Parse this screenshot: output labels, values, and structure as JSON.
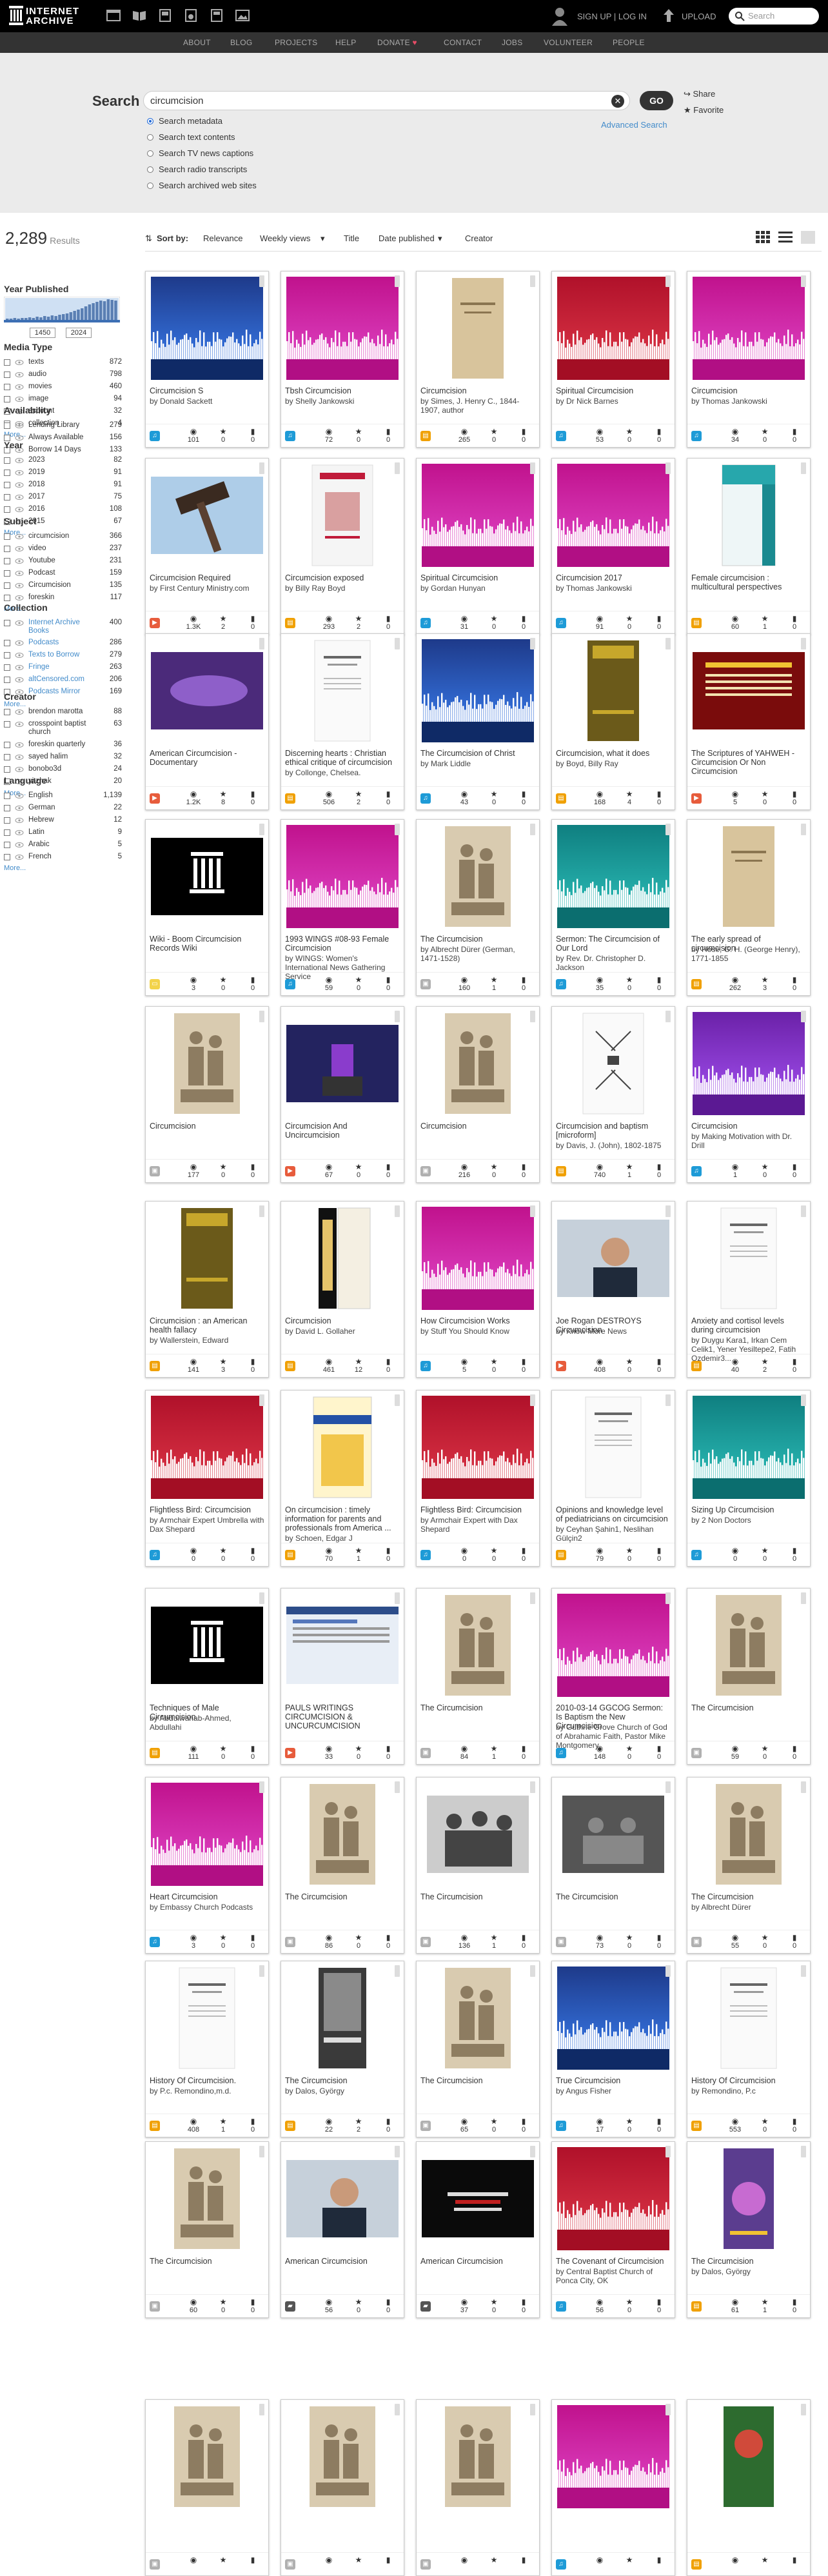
{
  "header": {
    "logo_line1": "INTERNET",
    "logo_line2": "ARCHIVE",
    "signup": "SIGN UP | LOG IN",
    "upload": "UPLOAD",
    "search_placeholder": "Search"
  },
  "nav": [
    "ABOUT",
    "BLOG",
    "PROJECTS",
    "HELP",
    "DONATE",
    "CONTACT",
    "JOBS",
    "VOLUNTEER",
    "PEOPLE"
  ],
  "search": {
    "label": "Search",
    "query": "circumcision",
    "go": "GO",
    "share": "Share",
    "favorite": "Favorite",
    "advanced": "Advanced Search",
    "options": [
      "Search metadata",
      "Search text contents",
      "Search TV news captions",
      "Search radio transcripts",
      "Search archived web sites"
    ]
  },
  "results": {
    "count": "2,289",
    "label": "Results"
  },
  "facets": {
    "year_published": {
      "title": "Year Published",
      "from": "1450",
      "to": "2024"
    },
    "media_type": {
      "title": "Media Type",
      "rows": [
        [
          "texts",
          "872"
        ],
        [
          "audio",
          "798"
        ],
        [
          "movies",
          "460"
        ],
        [
          "image",
          "94"
        ],
        [
          "account",
          "32"
        ],
        [
          "collection",
          "4"
        ]
      ],
      "more": "More..."
    },
    "availability": {
      "title": "Availability",
      "rows": [
        [
          "Lending Library",
          "279"
        ],
        [
          "Always Available",
          "156"
        ],
        [
          "Borrow 14 Days",
          "133"
        ]
      ]
    },
    "year": {
      "title": "Year",
      "rows": [
        [
          "2023",
          "82"
        ],
        [
          "2019",
          "91"
        ],
        [
          "2018",
          "91"
        ],
        [
          "2017",
          "75"
        ],
        [
          "2016",
          "108"
        ],
        [
          "2015",
          "67"
        ]
      ],
      "more": "More..."
    },
    "subject": {
      "title": "Subject",
      "rows": [
        [
          "circumcision",
          "366"
        ],
        [
          "video",
          "237"
        ],
        [
          "Youtube",
          "231"
        ],
        [
          "Podcast",
          "159"
        ],
        [
          "Circumcision",
          "135"
        ],
        [
          "foreskin",
          "117"
        ]
      ],
      "more": "More..."
    },
    "collection": {
      "title": "Collection",
      "rows": [
        [
          "Internet Archive Books",
          "400"
        ],
        [
          "Podcasts",
          "286"
        ],
        [
          "Texts to Borrow",
          "279"
        ],
        [
          "Fringe",
          "263"
        ],
        [
          "altCensored.com",
          "206"
        ],
        [
          "Podcasts Mirror",
          "169"
        ]
      ],
      "more": "More..."
    },
    "creator": {
      "title": "Creator",
      "rows": [
        [
          "brendon marotta",
          "88"
        ],
        [
          "crosspoint baptist church",
          "63"
        ],
        [
          "foreskin quarterly",
          "36"
        ],
        [
          "sayed halim",
          "32"
        ],
        [
          "bonobo3d",
          "24"
        ],
        [
          "yitzhak",
          "20"
        ]
      ],
      "more": "More..."
    },
    "language": {
      "title": "Language",
      "rows": [
        [
          "English",
          "1,139"
        ],
        [
          "German",
          "22"
        ],
        [
          "Hebrew",
          "12"
        ],
        [
          "Latin",
          "9"
        ],
        [
          "Arabic",
          "5"
        ],
        [
          "French",
          "5"
        ]
      ],
      "more": "More..."
    }
  },
  "sort": {
    "label": "Sort by:",
    "options": [
      "Relevance",
      "Weekly views",
      "Title",
      "Date published",
      "Creator"
    ]
  },
  "colors": {
    "topbar": "#000000",
    "navbar": "#333333",
    "search_bg": "#ebebeb",
    "link": "#428bca",
    "audio_badge": "#1e9bd7",
    "texts_badge": "#f0a000",
    "movies_badge": "#e75c3c",
    "image_badge": "#b0b0b0"
  },
  "cards": [
    {
      "title": "Circumcision S",
      "creator": "by Donald Sackett",
      "type": "audio",
      "views": "101",
      "favs": "0",
      "reviews": "0",
      "thumb": "wave-blue"
    },
    {
      "title": "Tbsh Circumcision",
      "creator": "by Shelly Jankowski",
      "type": "audio",
      "views": "72",
      "favs": "0",
      "reviews": "0",
      "thumb": "wave-magenta"
    },
    {
      "title": "Circumcision",
      "creator": "by Simes, J. Henry C., 1844-1907, author",
      "type": "texts",
      "views": "265",
      "favs": "0",
      "reviews": "0",
      "thumb": "book-tan"
    },
    {
      "title": "Spiritual Circumcision",
      "creator": "by Dr Nick Barnes",
      "type": "audio",
      "views": "53",
      "favs": "0",
      "reviews": "0",
      "thumb": "wave-red"
    },
    {
      "title": "Circumcision",
      "creator": "by Thomas Jankowski",
      "type": "audio",
      "views": "34",
      "favs": "0",
      "reviews": "0",
      "thumb": "wave-magenta"
    },
    {
      "title": "Circumcision Required",
      "creator": "by First Century Ministry.com",
      "type": "movies",
      "views": "1.3K",
      "favs": "2",
      "reviews": "0",
      "thumb": "video-hammer"
    },
    {
      "title": "Circumcision exposed",
      "creator": "by Billy Ray Boyd",
      "type": "texts",
      "views": "293",
      "favs": "2",
      "reviews": "0",
      "thumb": "book-cover"
    },
    {
      "title": "Spiritual Circumcision",
      "creator": "by Gordan Hunyan",
      "type": "audio",
      "views": "31",
      "favs": "0",
      "reviews": "0",
      "thumb": "wave-magenta"
    },
    {
      "title": "Circumcision 2017",
      "creator": "by Thomas Jankowski",
      "type": "audio",
      "views": "91",
      "favs": "0",
      "reviews": "0",
      "thumb": "wave-magenta"
    },
    {
      "title": "Female circumcision : multicultural perspectives",
      "creator": "",
      "type": "texts",
      "views": "60",
      "favs": "1",
      "reviews": "0",
      "thumb": "book-teal"
    },
    {
      "title": "American Circumcision - Documentary",
      "creator": "",
      "type": "movies",
      "views": "1.2K",
      "favs": "8",
      "reviews": "0",
      "thumb": "video-purple"
    },
    {
      "title": "Discerning hearts : Christian ethical critique of circumcision",
      "creator": "by Collonge, Chelsea.",
      "type": "texts",
      "views": "506",
      "favs": "2",
      "reviews": "0",
      "thumb": "book-white"
    },
    {
      "title": "The Circumcision of Christ",
      "creator": "by Mark Liddle",
      "type": "audio",
      "views": "43",
      "favs": "0",
      "reviews": "0",
      "thumb": "wave-blue"
    },
    {
      "title": "Circumcision, what it does",
      "creator": "by Boyd, Billy Ray",
      "type": "texts",
      "views": "168",
      "favs": "4",
      "reviews": "0",
      "thumb": "book-olive"
    },
    {
      "title": "The Scriptures of YAHWEH - Circumcision Or Non Circumcision",
      "creator": "",
      "type": "movies",
      "views": "5",
      "favs": "0",
      "reviews": "0",
      "thumb": "video-red"
    },
    {
      "title": "Wiki - Boom Circumcision Records Wiki",
      "creator": "",
      "type": "web",
      "views": "3",
      "favs": "0",
      "reviews": "0",
      "thumb": "temple"
    },
    {
      "title": "1993 WINGS #08-93 Female Circumcision",
      "creator": "by WINGS: Women's International News Gathering Service",
      "type": "audio",
      "views": "59",
      "favs": "0",
      "reviews": "0",
      "thumb": "wave-magenta"
    },
    {
      "title": "The Circumcision",
      "creator": "by Albrecht Dürer (German, 1471-1528)",
      "type": "image",
      "views": "160",
      "favs": "1",
      "reviews": "0",
      "thumb": "engraving"
    },
    {
      "title": "Sermon: The Circumcision of Our Lord",
      "creator": "by Rev. Dr. Christopher D. Jackson",
      "type": "audio",
      "views": "35",
      "favs": "0",
      "reviews": "0",
      "thumb": "wave-teal"
    },
    {
      "title": "The early spread of circumcision",
      "creator": "by Hose, G. H. (George Henry), 1771-1855",
      "type": "texts",
      "views": "262",
      "favs": "3",
      "reviews": "0",
      "thumb": "book-tan"
    },
    {
      "title": "Circumcision",
      "creator": "",
      "type": "image",
      "views": "177",
      "favs": "0",
      "reviews": "0",
      "thumb": "engraving"
    },
    {
      "title": "Circumcision And Uncircumcision",
      "creator": "",
      "type": "movies",
      "views": "67",
      "favs": "0",
      "reviews": "0",
      "thumb": "video-stage"
    },
    {
      "title": "Circumcision",
      "creator": "",
      "type": "image",
      "views": "216",
      "favs": "0",
      "reviews": "0",
      "thumb": "engraving"
    },
    {
      "title": "Circumcision and baptism [microform]",
      "creator": "by Davis, J. (John), 1802-1875",
      "type": "texts",
      "views": "740",
      "favs": "1",
      "reviews": "0",
      "thumb": "book-diagram"
    },
    {
      "title": "Circumcision",
      "creator": "by Making Motivation with Dr. Drill",
      "type": "audio",
      "views": "1",
      "favs": "0",
      "reviews": "0",
      "thumb": "wave-purple"
    },
    {
      "title": "Circumcision : an American health fallacy",
      "creator": "by Wallerstein, Edward",
      "type": "texts",
      "views": "141",
      "favs": "3",
      "reviews": "0",
      "thumb": "book-olive"
    },
    {
      "title": "Circumcision",
      "creator": "by David L. Gollaher",
      "type": "texts",
      "views": "461",
      "favs": "12",
      "reviews": "0",
      "thumb": "book-black"
    },
    {
      "title": "How Circumcision Works",
      "creator": "by Stuff You Should Know",
      "type": "audio",
      "views": "5",
      "favs": "0",
      "reviews": "0",
      "thumb": "wave-magenta"
    },
    {
      "title": "Joe Rogan DESTROYS Circumcision",
      "creator": "by Know More News",
      "type": "movies",
      "views": "408",
      "favs": "0",
      "reviews": "0",
      "thumb": "video-man"
    },
    {
      "title": "Anxiety and cortisol levels during circumcision",
      "creator": "by Duygu Kara1, Irkan Cem Celik1, Yener Yesiltepe2, Fatih Ozdemir3...",
      "type": "texts",
      "views": "40",
      "favs": "2",
      "reviews": "0",
      "thumb": "book-white"
    },
    {
      "title": "Flightless Bird: Circumcision",
      "creator": "by Armchair Expert Umbrella with Dax Shepard",
      "type": "audio",
      "views": "0",
      "favs": "0",
      "reviews": "0",
      "thumb": "wave-red"
    },
    {
      "title": "On circumcision : timely information for parents and professionals from America ...",
      "creator": "by Schoen, Edgar J",
      "type": "texts",
      "views": "70",
      "favs": "1",
      "reviews": "0",
      "thumb": "book-yellow"
    },
    {
      "title": "Flightless Bird: Circumcision",
      "creator": "by Armchair Expert with Dax Shepard",
      "type": "audio",
      "views": "0",
      "favs": "0",
      "reviews": "0",
      "thumb": "wave-red"
    },
    {
      "title": "Opinions and knowledge level of pediatricians on circumcision",
      "creator": "by Ceyhan Şahin1, Neslihan Gülçin2",
      "type": "texts",
      "views": "79",
      "favs": "0",
      "reviews": "0",
      "thumb": "book-white"
    },
    {
      "title": "Sizing Up Circumcision",
      "creator": "by 2 Non Doctors",
      "type": "audio",
      "views": "0",
      "favs": "0",
      "reviews": "0",
      "thumb": "wave-teal"
    },
    {
      "title": "Techniques of Male Circumcision.",
      "creator": "by Abdulwahab-Ahmed, Abdullahi",
      "type": "texts",
      "views": "111",
      "favs": "0",
      "reviews": "0",
      "thumb": "temple"
    },
    {
      "title": "PAULS WRITINGS CIRCUMCISION & UNCURCUMCISION",
      "creator": "",
      "type": "movies",
      "views": "33",
      "favs": "0",
      "reviews": "0",
      "thumb": "video-screen"
    },
    {
      "title": "The Circumcision",
      "creator": "",
      "type": "image",
      "views": "84",
      "favs": "1",
      "reviews": "0",
      "thumb": "engraving"
    },
    {
      "title": "2010-03-14 GGCOG Sermon: Is Baptism the New Circumcision",
      "creator": "by Guthrie Grove Church of God of Abrahamic Faith, Pastor Mike Montgomery",
      "type": "audio",
      "views": "148",
      "favs": "0",
      "reviews": "0",
      "thumb": "wave-magenta"
    },
    {
      "title": "The Circumcision",
      "creator": "",
      "type": "image",
      "views": "59",
      "favs": "0",
      "reviews": "0",
      "thumb": "engraving"
    },
    {
      "title": "Heart Circumcision",
      "creator": "by Embassy Church Podcasts",
      "type": "audio",
      "views": "3",
      "favs": "0",
      "reviews": "0",
      "thumb": "wave-magenta"
    },
    {
      "title": "The Circumcision",
      "creator": "",
      "type": "image",
      "views": "86",
      "favs": "0",
      "reviews": "0",
      "thumb": "engraving"
    },
    {
      "title": "The Circumcision",
      "creator": "",
      "type": "image",
      "views": "136",
      "favs": "1",
      "reviews": "0",
      "thumb": "engraving-bw"
    },
    {
      "title": "The Circumcision",
      "creator": "",
      "type": "image",
      "views": "73",
      "favs": "0",
      "reviews": "0",
      "thumb": "engraving-dark"
    },
    {
      "title": "The Circumcision",
      "creator": "by Albrecht Dürer",
      "type": "image",
      "views": "55",
      "favs": "0",
      "reviews": "0",
      "thumb": "engraving"
    },
    {
      "title": "History Of Circumcision.",
      "creator": "by P.c. Remondino,m.d.",
      "type": "texts",
      "views": "408",
      "favs": "1",
      "reviews": "0",
      "thumb": "book-white"
    },
    {
      "title": "The Circumcision",
      "creator": "by Dalos, György",
      "type": "texts",
      "views": "22",
      "favs": "2",
      "reviews": "0",
      "thumb": "book-photo"
    },
    {
      "title": "The Circumcision",
      "creator": "",
      "type": "image",
      "views": "65",
      "favs": "0",
      "reviews": "0",
      "thumb": "engraving"
    },
    {
      "title": "True Circumcision",
      "creator": "by Angus Fisher",
      "type": "audio",
      "views": "17",
      "favs": "0",
      "reviews": "0",
      "thumb": "wave-blue"
    },
    {
      "title": "History Of Circumcision",
      "creator": "by Remondino, P.c",
      "type": "texts",
      "views": "553",
      "favs": "0",
      "reviews": "0",
      "thumb": "book-white"
    },
    {
      "title": "The Circumcision",
      "creator": "",
      "type": "image",
      "views": "60",
      "favs": "0",
      "reviews": "0",
      "thumb": "engraving"
    },
    {
      "title": "American Circumcision",
      "creator": "",
      "type": "collection",
      "views": "56",
      "favs": "0",
      "reviews": "0",
      "thumb": "video-man"
    },
    {
      "title": "American Circumcision",
      "creator": "",
      "type": "collection",
      "views": "37",
      "favs": "0",
      "reviews": "0",
      "thumb": "video-black"
    },
    {
      "title": "The Covenant of Circumcision",
      "creator": "by Central Baptist Church of Ponca City, OK",
      "type": "audio",
      "views": "56",
      "favs": "0",
      "reviews": "0",
      "thumb": "wave-red"
    },
    {
      "title": "The Circumcision",
      "creator": "by Dalos, György",
      "type": "texts",
      "views": "61",
      "favs": "1",
      "reviews": "0",
      "thumb": "book-purple"
    },
    {
      "title": "",
      "creator": "",
      "type": "image",
      "views": "",
      "favs": "",
      "reviews": "",
      "thumb": "engraving"
    },
    {
      "title": "",
      "creator": "",
      "type": "image",
      "views": "",
      "favs": "",
      "reviews": "",
      "thumb": "engraving"
    },
    {
      "title": "",
      "creator": "",
      "type": "image",
      "views": "",
      "favs": "",
      "reviews": "",
      "thumb": "engraving"
    },
    {
      "title": "",
      "creator": "",
      "type": "audio",
      "views": "",
      "favs": "",
      "reviews": "",
      "thumb": "wave-magenta"
    },
    {
      "title": "",
      "creator": "",
      "type": "texts",
      "views": "",
      "favs": "",
      "reviews": "",
      "thumb": "book-green"
    }
  ]
}
